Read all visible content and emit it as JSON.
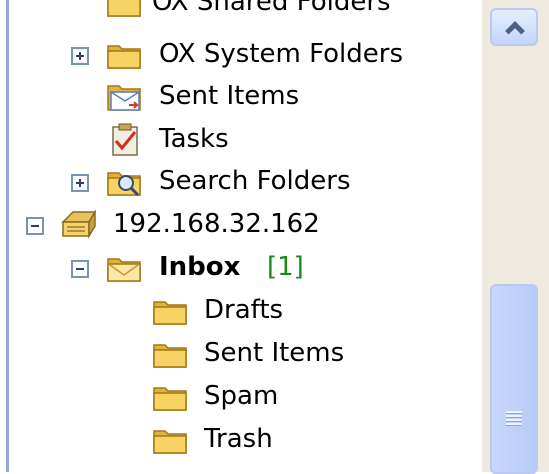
{
  "tree": {
    "items": [
      {
        "label": "OX Shared Folders",
        "icon": "folder-icon"
      },
      {
        "label": "OX System Folders",
        "icon": "folder-icon",
        "expander": "plus"
      },
      {
        "label": "Sent Items",
        "icon": "sent-items-icon"
      },
      {
        "label": "Tasks",
        "icon": "tasks-icon"
      },
      {
        "label": "Search Folders",
        "icon": "search-folder-icon",
        "expander": "plus"
      },
      {
        "label": "192.168.32.162",
        "icon": "mailbox-icon",
        "expander": "minus"
      },
      {
        "label": "Inbox",
        "count": "[1]",
        "icon": "inbox-icon",
        "expander": "minus"
      },
      {
        "label": "Drafts",
        "icon": "folder-icon"
      },
      {
        "label": "Sent Items",
        "icon": "folder-icon"
      },
      {
        "label": "Spam",
        "icon": "folder-icon"
      },
      {
        "label": "Trash",
        "icon": "folder-icon"
      }
    ]
  },
  "colors": {
    "count": "#1b8a1b",
    "folder": "#f5c94a",
    "scrollbar": "#c3d4fb"
  }
}
